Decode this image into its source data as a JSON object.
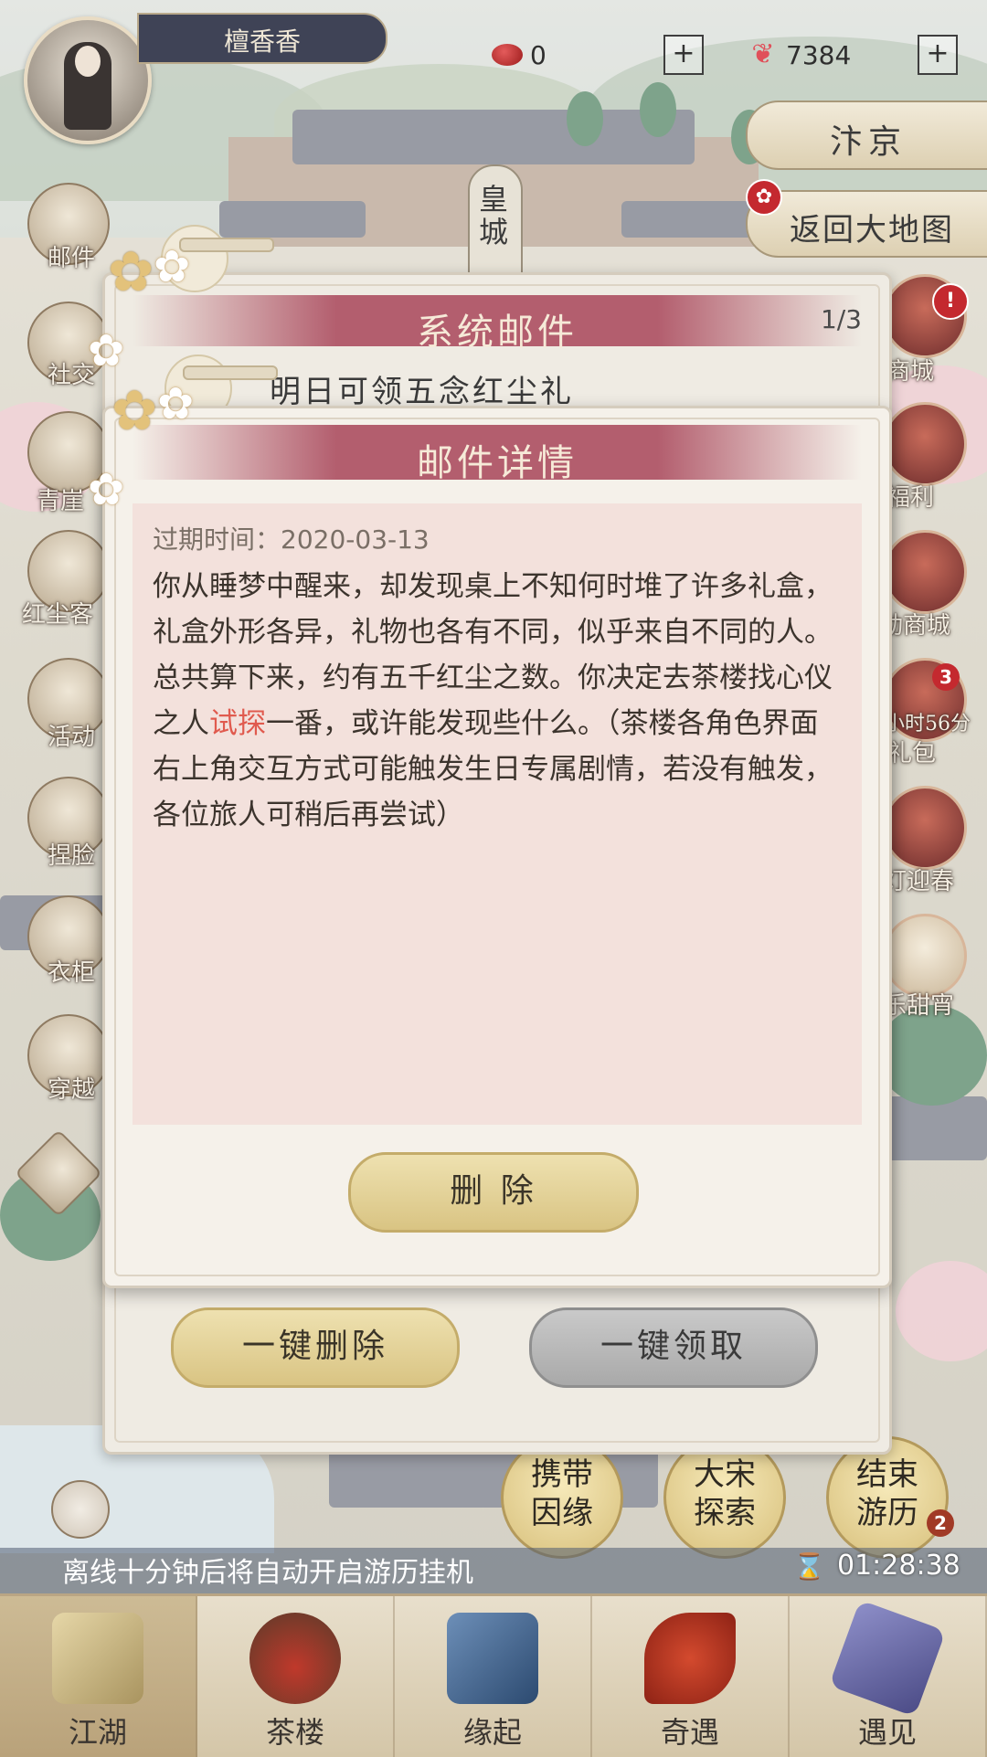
{
  "header": {
    "player_name": "檀香香",
    "gem_count": "0",
    "butterfly_count": "7384",
    "plus_label": "+",
    "city_label": "汴京",
    "return_label": "返回大地图",
    "palace_sign": "皇城"
  },
  "left_menu": [
    {
      "label": "邮件"
    },
    {
      "label": "社交"
    },
    {
      "label": "青崖"
    },
    {
      "label": "红尘客"
    },
    {
      "label": "活动"
    },
    {
      "label": "捏脸"
    },
    {
      "label": "衣柜"
    },
    {
      "label": "穿越"
    }
  ],
  "right_menu": [
    {
      "label": "商城",
      "badge": "!"
    },
    {
      "label": "福利"
    },
    {
      "label": "动商城"
    },
    {
      "label": "小时56分",
      "sub": "礼包",
      "badge": "3"
    },
    {
      "label": "灯迎春"
    },
    {
      "label": "乐甜宵"
    }
  ],
  "mail_panel": {
    "title": "系统邮件",
    "page": "1/3",
    "item_text": "明日可领五念红尘礼",
    "delete_all": "一键删除",
    "claim_all": "一键领取"
  },
  "detail_panel": {
    "title": "邮件详情",
    "expire_label": "过期时间：",
    "expire_date": "2020-03-13",
    "body_before": "你从睡梦中醒来，却发现桌上不知何时堆了许多礼盒，礼盒外形各异，礼物也各有不同，似乎来自不同的人。总共算下来，约有五千红尘之数。你决定去茶楼找心仪之人",
    "body_highlight": "试探",
    "body_after": "一番，或许能发现些什么。（茶楼各角色界面右上角交互方式可能触发生日专属剧情，若没有触发，各位旅人可稍后再尝试）",
    "delete_label": "删 除"
  },
  "actions": {
    "carry_fate": "携带因缘",
    "song_explore": "大宋探索",
    "end_travel": "结束游历",
    "end_travel_badge": "2"
  },
  "status": {
    "auto_text": "离线十分钟后将自动开启游历挂机",
    "timer": "01:28:38"
  },
  "nav": [
    {
      "label": "江湖",
      "active": true
    },
    {
      "label": "茶楼"
    },
    {
      "label": "缘起"
    },
    {
      "label": "奇遇"
    },
    {
      "label": "遇见"
    }
  ],
  "colors": {
    "accent_title": "#b35e6e",
    "highlight_text": "#e05a4e",
    "badge_red": "#c4292f"
  }
}
